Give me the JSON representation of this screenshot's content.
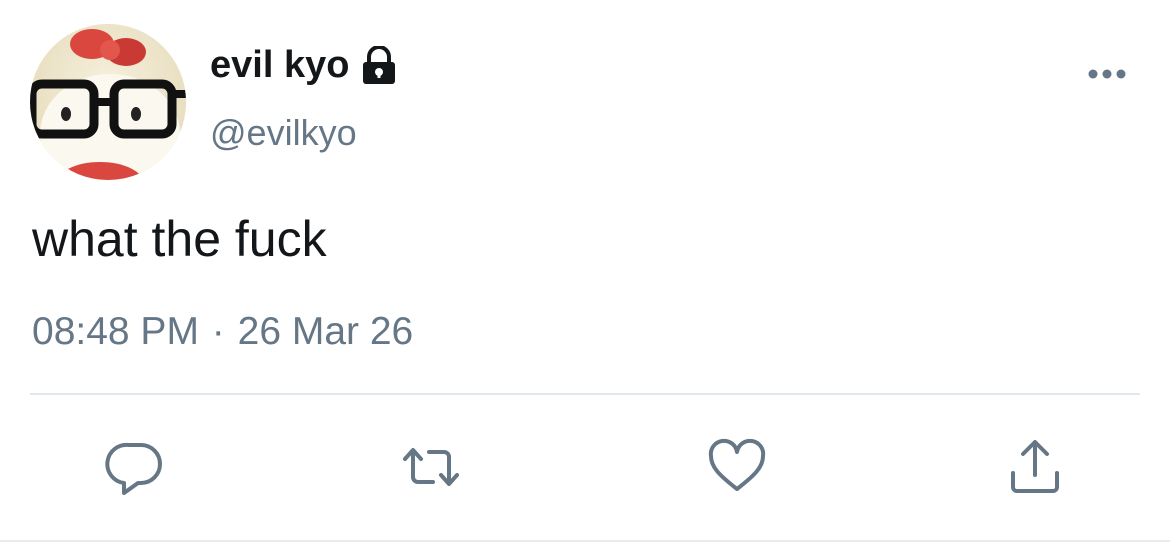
{
  "tweet": {
    "user": {
      "display_name": "evil kyo",
      "handle": "@evilkyo",
      "protected_icon": "lock-icon",
      "avatar": "avatar-hello-kitty-with-glasses"
    },
    "text": "what the fuck",
    "time": "08:48 PM",
    "separator": "·",
    "date": "26 Mar 26",
    "more_icon": "more-dots-icon"
  },
  "actions": [
    {
      "name": "reply",
      "icon": "reply-icon"
    },
    {
      "name": "retweet",
      "icon": "retweet-icon"
    },
    {
      "name": "like",
      "icon": "heart-icon"
    },
    {
      "name": "share",
      "icon": "share-icon"
    }
  ],
  "colors": {
    "primary_text": "#14171a",
    "secondary_text": "#657786",
    "divider": "#e1e8ed",
    "icon": "#657786"
  }
}
